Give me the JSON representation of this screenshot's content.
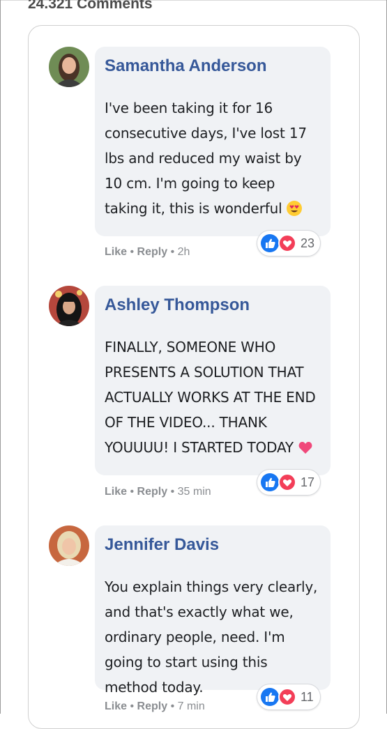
{
  "header": {
    "comment_count": "24.321 Comments"
  },
  "meta_separator": "•",
  "comments": [
    {
      "author": "Samantha Anderson",
      "text": "I've been taking it for 16 consecutive days, I've lost 17 lbs and reduced my waist by 10 cm. I'm going to keep taking it, this is wonderful",
      "emoji": "heart-eyes-emoji",
      "reactions": "23",
      "like": "Like",
      "reply": "Reply",
      "time": "2h"
    },
    {
      "author": "Ashley Thompson",
      "text": "FINALLY, SOMEONE WHO PRESENTS A SOLUTION THAT ACTUALLY WORKS AT THE END OF THE VIDEO... THANK YOUUUU! I STARTED TODAY",
      "emoji": "pink-heart-emoji",
      "reactions": "17",
      "like": "Like",
      "reply": "Reply",
      "time": "35 min"
    },
    {
      "author": "Jennifer Davis",
      "text": "You explain things very clearly, and that's exactly what we, ordinary people, need. I'm going to start using this method today.",
      "reactions": "11",
      "like": "Like",
      "reply": "Reply",
      "time": "7 min"
    }
  ],
  "colors": {
    "author": "#365899",
    "bubble": "#f0f2f5",
    "like": "#1877f2",
    "love": "#f33e58"
  }
}
